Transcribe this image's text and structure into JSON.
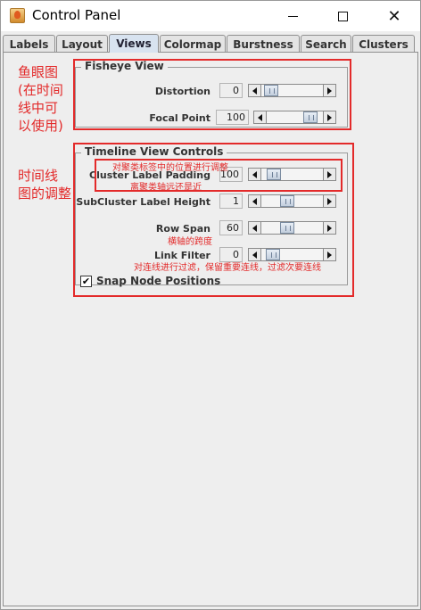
{
  "window": {
    "title": "Control Panel",
    "app_icon": "java-cup-icon",
    "controls": [
      "minimize-icon",
      "maximize-icon",
      "close-icon"
    ]
  },
  "tabs": [
    {
      "label": "Labels",
      "active": false
    },
    {
      "label": "Layout",
      "active": false
    },
    {
      "label": "Views",
      "active": true
    },
    {
      "label": "Colormap",
      "active": false
    },
    {
      "label": "Burstness",
      "active": false
    },
    {
      "label": "Search",
      "active": false
    },
    {
      "label": "Clusters",
      "active": false
    }
  ],
  "fisheye": {
    "title": "Fisheye View",
    "rows": [
      {
        "label": "Distortion",
        "value": "0",
        "fraction": 0.04
      },
      {
        "label": "Focal Point",
        "value": "100",
        "fraction": 0.88
      }
    ]
  },
  "timeline": {
    "title": "Timeline View Controls",
    "rows": [
      {
        "label": "Cluster Label Padding",
        "value": "100",
        "fraction": 0.1
      },
      {
        "label": "SubCluster Label Height",
        "value": "1",
        "fraction": 0.4
      },
      {
        "label": "Row Span",
        "value": "60",
        "fraction": 0.4
      },
      {
        "label": "Link Filter",
        "value": "0",
        "fraction": 0.08
      }
    ],
    "snap": {
      "label": "Snap Node Positions",
      "checked": true
    }
  },
  "annotations": {
    "fisheye_note": [
      "鱼眼图",
      "(在时间",
      "线中可",
      "以使用)"
    ],
    "timeline_note": [
      "时间线",
      "图的调整"
    ],
    "padding_note_top": "对聚类标签中的位置进行调整",
    "padding_note_bottom": "离聚类轴远还是近",
    "rowspan_note": "横轴的跨度",
    "linkfilter_note": "对连线进行过滤，保留重要连线，过滤次要连线"
  },
  "colors": {
    "annotation": "#e32a2a",
    "active_tab": "#d8e3f0",
    "panel_bg": "#eeeeee"
  }
}
